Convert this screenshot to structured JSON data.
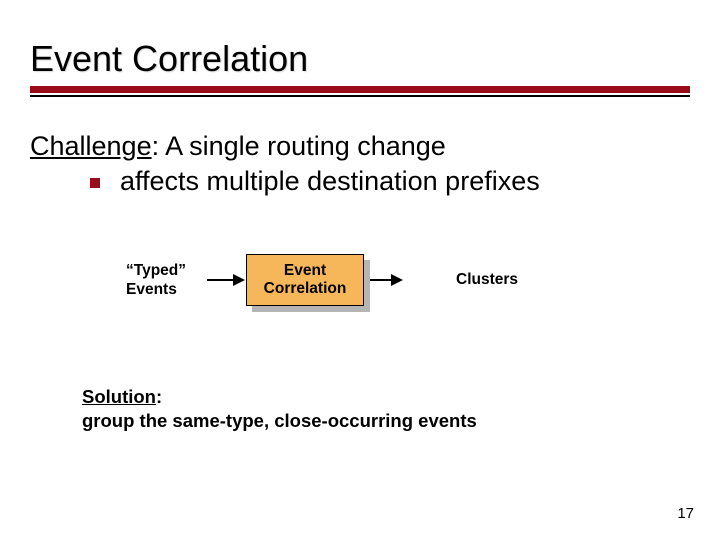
{
  "title": "Event Correlation",
  "challenge_label": "Challenge",
  "challenge_rest": ": A single routing change",
  "challenge_sub": "affects multiple destination prefixes",
  "typed_events_l1": "“Typed”",
  "typed_events_l2": "Events",
  "ec_box_l1": "Event",
  "ec_box_l2": "Correlation",
  "clusters": "Clusters",
  "solution_label": "Solution",
  "solution_rest": ":",
  "solution_line2": "group the same-type, close-occurring events",
  "page_number": "17",
  "colors": {
    "accent": "#9a0c1a",
    "box_fill": "#f6b65a",
    "shadow": "#b5b5b5"
  }
}
